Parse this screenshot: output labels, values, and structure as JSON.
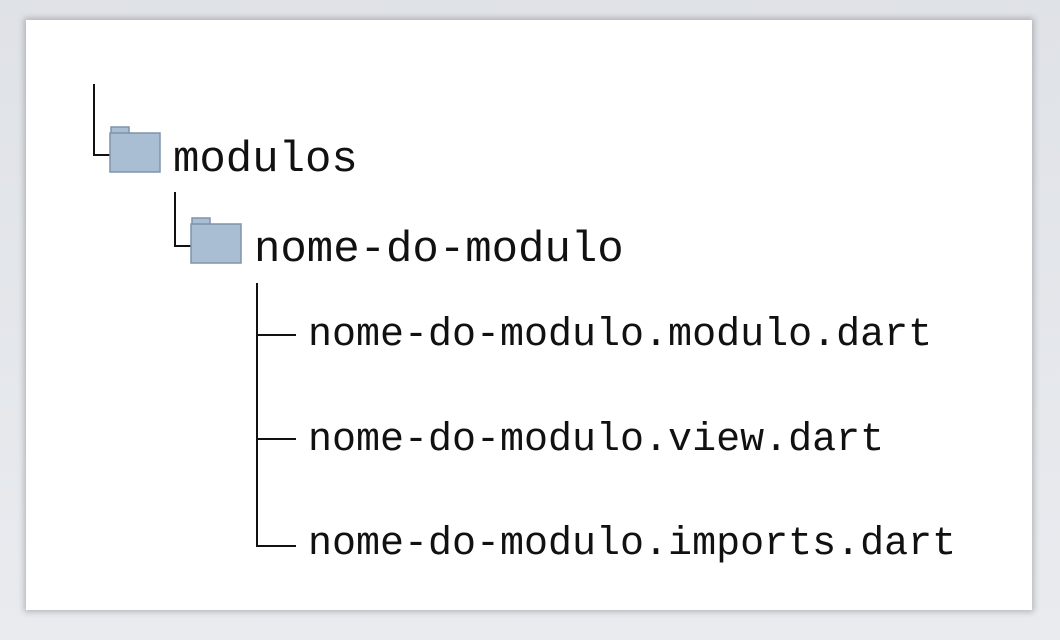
{
  "tree": {
    "root_folder": {
      "label": "modulos",
      "icon": "folder-icon",
      "child_folder": {
        "label": "nome-do-modulo",
        "icon": "folder-icon",
        "files": [
          {
            "label": "nome-do-modulo.modulo.dart"
          },
          {
            "label": "nome-do-modulo.view.dart"
          },
          {
            "label": "nome-do-modulo.imports.dart"
          }
        ]
      }
    }
  },
  "colors": {
    "folder_fill": "#a9bdd3",
    "folder_stroke": "#7f93aa",
    "line": "#111111",
    "text": "#111111"
  }
}
